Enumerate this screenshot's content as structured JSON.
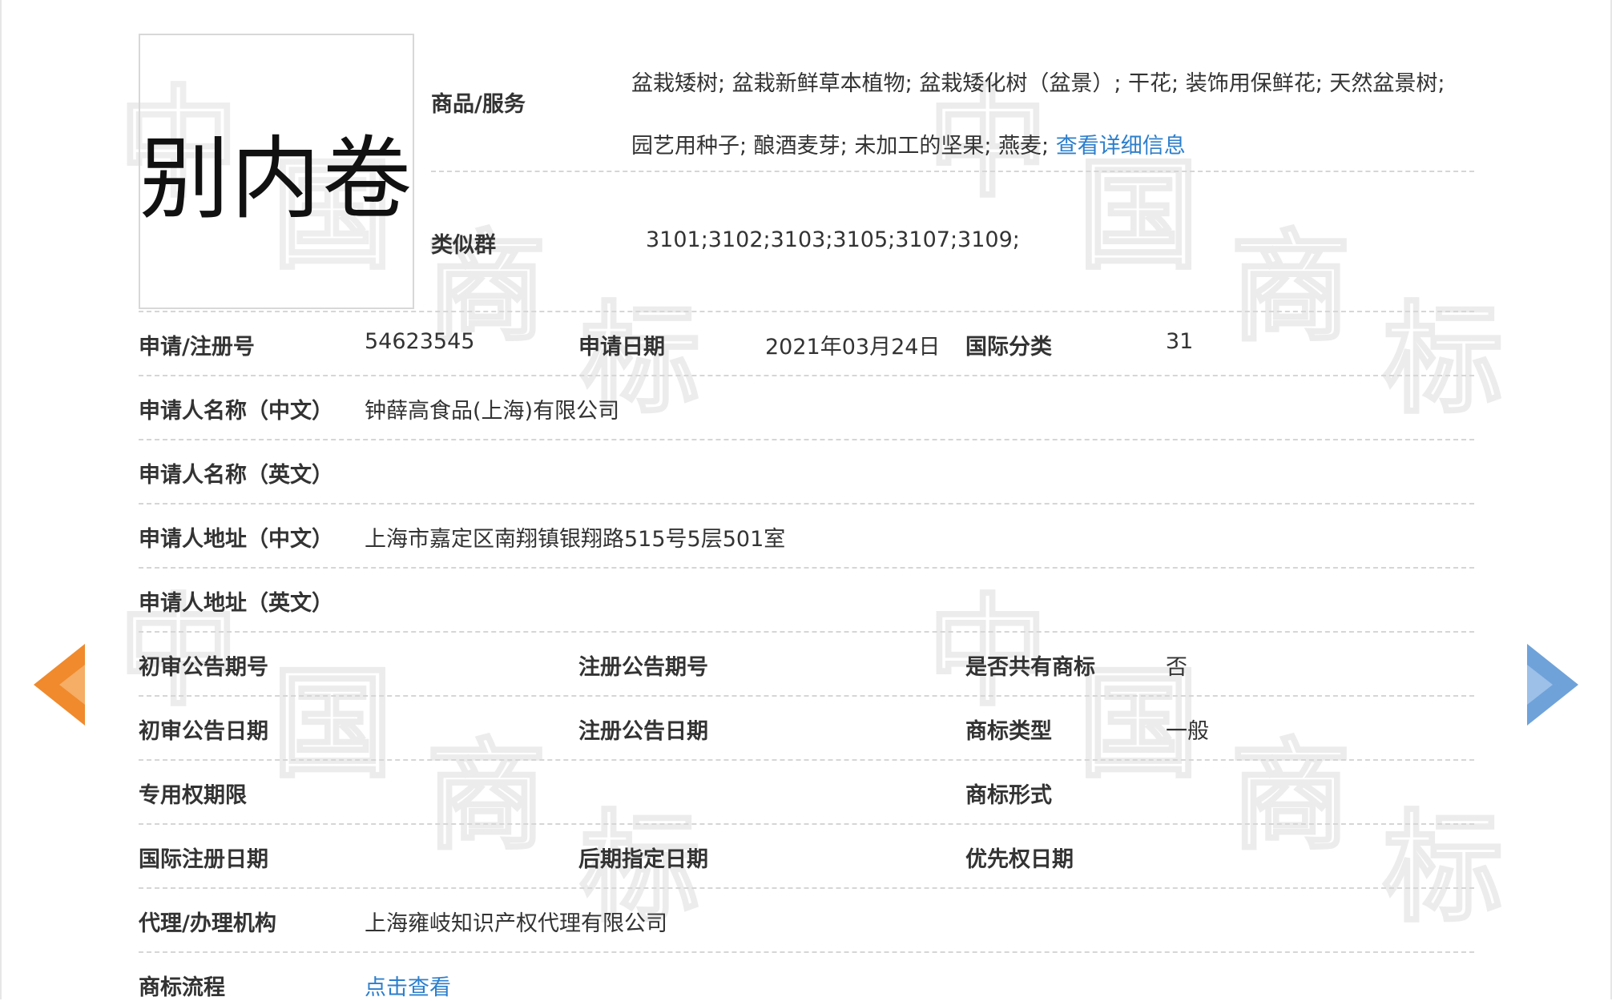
{
  "trademark": {
    "name": "别内卷"
  },
  "goods_services": {
    "label": "商品/服务",
    "line1": "盆栽矮树; 盆栽新鲜草本植物; 盆栽矮化树（盆景）; 干花; 装饰用保鲜花; 天然盆景树;",
    "line2": "园艺用种子; 酿酒麦芽; 未加工的坚果; 燕麦;",
    "detail_link": "查看详细信息"
  },
  "similar_group": {
    "label": "类似群",
    "value": "3101;3102;3103;3105;3107;3109;"
  },
  "fields": {
    "reg_no": {
      "label": "申请/注册号",
      "value": "54623545"
    },
    "app_date": {
      "label": "申请日期",
      "value": "2021年03月24日"
    },
    "intl_class": {
      "label": "国际分类",
      "value": "31"
    },
    "applicant_cn": {
      "label": "申请人名称（中文）",
      "value": "钟薛高食品(上海)有限公司"
    },
    "applicant_en": {
      "label": "申请人名称（英文）",
      "value": ""
    },
    "address_cn": {
      "label": "申请人地址（中文）",
      "value": "上海市嘉定区南翔镇银翔路515号5层501室"
    },
    "address_en": {
      "label": "申请人地址（英文）",
      "value": ""
    },
    "prelim_issue": {
      "label": "初审公告期号",
      "value": ""
    },
    "reg_issue": {
      "label": "注册公告期号",
      "value": ""
    },
    "shared_mark": {
      "label": "是否共有商标",
      "value": "否"
    },
    "prelim_date": {
      "label": "初审公告日期",
      "value": ""
    },
    "reg_date": {
      "label": "注册公告日期",
      "value": ""
    },
    "mark_type": {
      "label": "商标类型",
      "value": "一般"
    },
    "exclusive_period": {
      "label": "专用权期限",
      "value": ""
    },
    "mark_form": {
      "label": "商标形式",
      "value": ""
    },
    "intl_reg_date": {
      "label": "国际注册日期",
      "value": ""
    },
    "later_designation": {
      "label": "后期指定日期",
      "value": ""
    },
    "priority_date": {
      "label": "优先权日期",
      "value": ""
    },
    "agent": {
      "label": "代理/办理机构",
      "value": "上海雍岐知识产权代理有限公司"
    },
    "process": {
      "label": "商标流程",
      "value": "点击查看"
    }
  },
  "watermark": {
    "glyphs": [
      "中",
      "国",
      "商",
      "标"
    ]
  },
  "nav": {
    "prev_icon": "arrow-left-icon",
    "next_icon": "arrow-right-icon",
    "prev_color": "#f08a2c",
    "next_color": "#6fa2d9"
  },
  "colors": {
    "link": "#2d7fcc",
    "divider": "#d6d6d6",
    "text": "#333333"
  }
}
